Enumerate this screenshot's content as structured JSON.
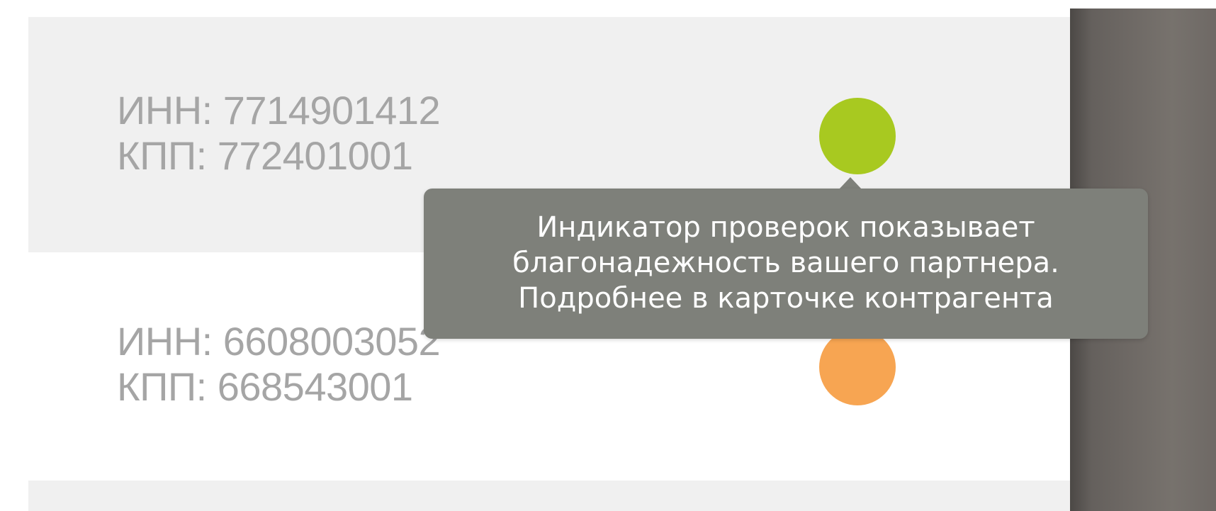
{
  "rows": [
    {
      "inn": "ИНН: 7714901412",
      "kpp": "КПП: 772401001",
      "indicator_color": "#a8c920",
      "indicator_status": "green"
    },
    {
      "inn": "ИНН: 6608003052",
      "kpp": "КПП: 668543001",
      "indicator_color": "#f7a552",
      "indicator_status": "orange"
    }
  ],
  "tooltip": {
    "lines": [
      "Индикатор проверок показывает",
      "благонадежность вашего партнера.",
      "Подробнее в карточке контрагента"
    ]
  },
  "colors": {
    "row_alt_background": "#f0f0f0",
    "id_text": "#a5a5a5",
    "tooltip_background": "#7e807a",
    "tooltip_text": "#ffffff"
  }
}
